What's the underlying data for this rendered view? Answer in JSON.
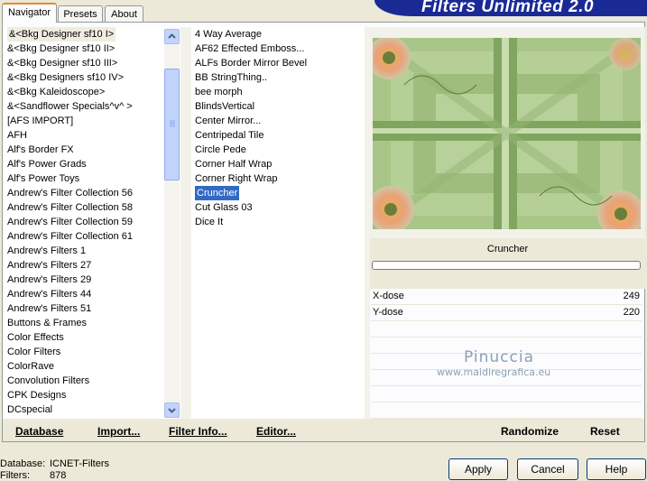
{
  "tabs": [
    {
      "label": "Navigator"
    },
    {
      "label": "Presets"
    },
    {
      "label": "About"
    }
  ],
  "banner_title": "Filters Unlimited 2.0",
  "categories": [
    "&<Bkg Designer sf10 I>",
    "&<Bkg Designer sf10 II>",
    "&<Bkg Designer sf10 III>",
    "&<Bkg Designers sf10 IV>",
    "&<Bkg Kaleidoscope>",
    "&<Sandflower Specials^v^ >",
    "[AFS IMPORT]",
    "AFH",
    "Alf's Border FX",
    "Alf's Power Grads",
    "Alf's Power Toys",
    "Andrew's Filter Collection 56",
    "Andrew's Filter Collection 58",
    "Andrew's Filter Collection 59",
    "Andrew's Filter Collection 61",
    "Andrew's Filters 1",
    "Andrew's Filters 27",
    "Andrew's Filters 29",
    "Andrew's Filters 44",
    "Andrew's Filters 51",
    "Buttons & Frames",
    "Color Effects",
    "Color Filters",
    "ColorRave",
    "Convolution Filters",
    "CPK Designs",
    "DCspecial"
  ],
  "filters": [
    "4 Way Average",
    "AF62 Effected Emboss...",
    "ALFs Border Mirror Bevel",
    "BB StringThing..",
    "bee morph",
    "BlindsVertical",
    "Center Mirror...",
    "Centripedal Tile",
    "Circle Pede",
    "Corner Half Wrap",
    "Corner Right Wrap",
    "Cruncher",
    "Cut Glass 03",
    "Dice It"
  ],
  "selected_filter_name": "Cruncher",
  "params": [
    {
      "label": "X-dose",
      "value": "249"
    },
    {
      "label": "Y-dose",
      "value": "220"
    }
  ],
  "watermark": {
    "name": "Pinuccia",
    "url": "www.maidiregrafica.eu"
  },
  "bottom_links": {
    "database": "Database",
    "import": "Import...",
    "filter_info": "Filter Info...",
    "editor": "Editor...",
    "randomize": "Randomize",
    "reset": "Reset"
  },
  "status": {
    "database_label": "Database:",
    "database_value": "ICNET-Filters",
    "filters_label": "Filters:",
    "filters_value": "878"
  },
  "buttons": {
    "apply": "Apply",
    "cancel": "Cancel",
    "help": "Help"
  },
  "colors": {
    "selection": "#316ac5",
    "banner": "#1a2a94"
  }
}
